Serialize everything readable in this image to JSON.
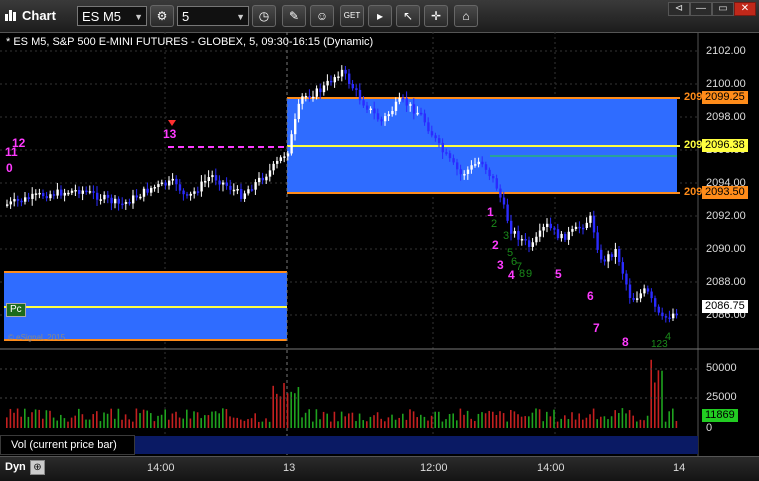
{
  "window": {
    "title": "Chart"
  },
  "toolbar": {
    "symbol": "ES M5",
    "interval": "5",
    "icons": [
      "clock-icon",
      "pencil-icon",
      "smiley-icon",
      "ticker-icon",
      "play-icon",
      "cursor-icon",
      "cross-icon",
      "tag-icon"
    ]
  },
  "chart": {
    "title": "* ES M5, S&P 500 E-MINI FUTURES - GLOBEX, 5, 09:30-16:15 (Dynamic)",
    "copyright": "© eSignal, 2015",
    "pc_label": "Pc",
    "price_axis": [
      "2102.00",
      "2100.00",
      "2098.00",
      "2096.00",
      "2094.00",
      "2092.00",
      "2090.00",
      "2088.00",
      "2086.00"
    ],
    "time_axis": [
      "14:00",
      "13",
      "12:00",
      "14:00",
      "14"
    ],
    "current_price": "2086.75",
    "levels": [
      {
        "prefix": "209",
        "value": "2099.25",
        "color": "#ff8c1a"
      },
      {
        "prefix": "209",
        "value": "2096.38",
        "color": "#ffff40"
      },
      {
        "prefix": "209",
        "value": "2093.50",
        "color": "#ff8c1a"
      }
    ],
    "prior_counts": [
      "12",
      "11",
      "0",
      "13"
    ],
    "magenta_counts": [
      "1",
      "2",
      "3",
      "4",
      "5",
      "6",
      "7",
      "8"
    ],
    "green_counts": [
      "2",
      "3",
      "5",
      "6",
      "7",
      "8",
      "9",
      "4",
      "123"
    ]
  },
  "volume": {
    "label": "Vol (current price bar)",
    "axis": [
      "50000",
      "25000",
      "0"
    ],
    "current": "11869"
  },
  "bottom": {
    "mode": "Dyn"
  },
  "colors": {
    "bull": "#ffffff",
    "bear": "#2b2bff",
    "zone": "#2f6cff",
    "orange": "#ff8c1a",
    "yellow": "#ffff40",
    "magenta": "#ff3bff",
    "green": "#1a8a1a"
  }
}
